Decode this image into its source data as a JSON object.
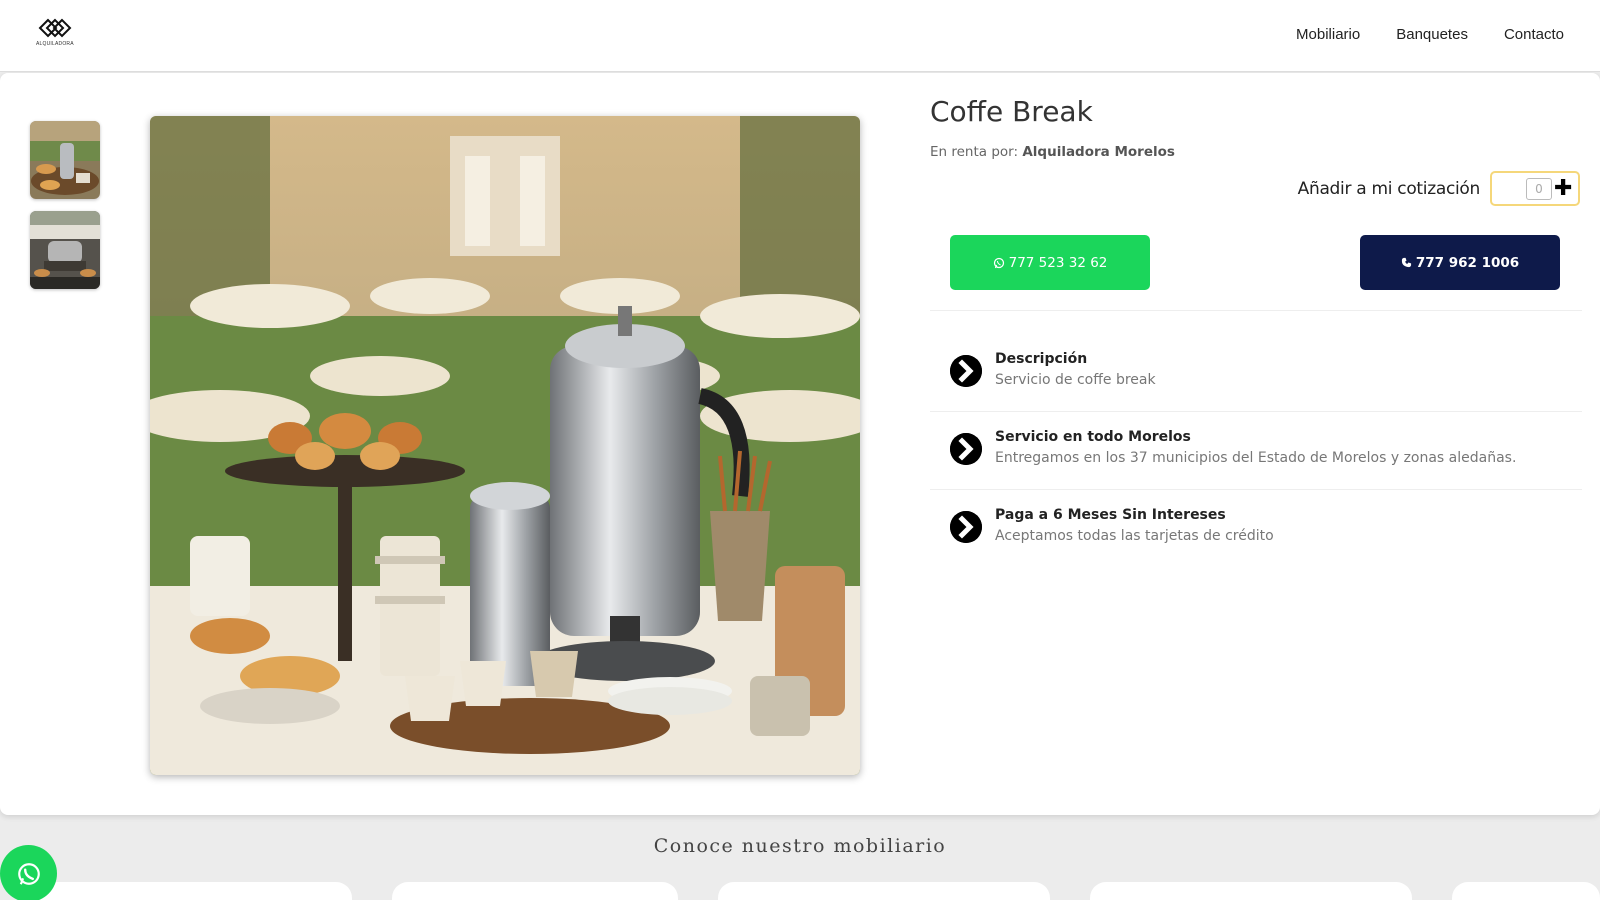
{
  "header": {
    "logo_text": "ALQUILADORA",
    "nav": [
      "Mobiliario",
      "Banquetes",
      "Contacto"
    ]
  },
  "product": {
    "title": "Coffe Break",
    "rented_by_label": "En renta por:",
    "rented_by_name": "Alquiladora Morelos",
    "add_quote_label": "Añadir a mi cotización",
    "quantity": "0",
    "whatsapp_number": "777 523 32 62",
    "phone_number": "777 962 1006"
  },
  "features": [
    {
      "title": "Descripción",
      "description": "Servicio de coffe break"
    },
    {
      "title": "Servicio en todo Morelos",
      "description": "Entregamos en los 37 municipios del Estado de Morelos y zonas aledañas."
    },
    {
      "title": "Paga a 6 Meses Sin Intereses",
      "description": "Aceptamos todas las tarjetas de crédito"
    }
  ],
  "section": {
    "title": "Conoce nuestro mobiliario"
  },
  "colors": {
    "whatsapp_green": "#1bd65b",
    "navy": "#0e1a4a",
    "quote_border": "#f5d77a"
  },
  "icons": {
    "feature": "chevron-circle-right-icon",
    "whatsapp": "whatsapp-icon",
    "phone": "phone-icon",
    "plus": "plus-icon"
  }
}
